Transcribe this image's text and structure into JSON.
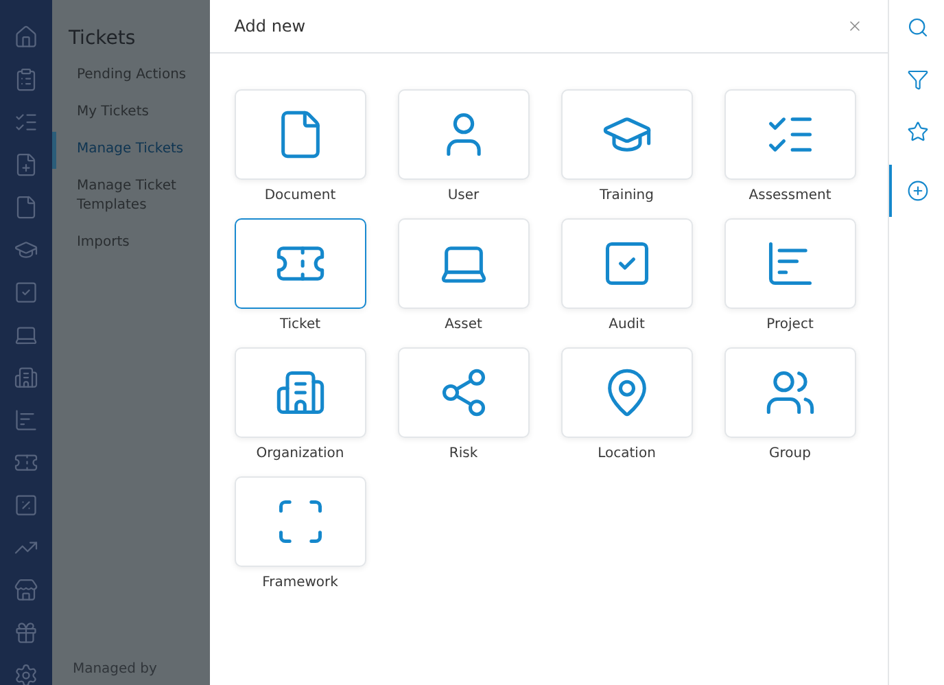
{
  "icon_rail": {
    "items": [
      {
        "kind": "home"
      },
      {
        "kind": "clipboard"
      },
      {
        "kind": "checklist"
      },
      {
        "kind": "file-plus"
      },
      {
        "kind": "file"
      },
      {
        "kind": "cap"
      },
      {
        "kind": "audit"
      },
      {
        "kind": "laptop"
      },
      {
        "kind": "building"
      },
      {
        "kind": "chart"
      },
      {
        "kind": "ticket"
      },
      {
        "kind": "percent"
      },
      {
        "kind": "trend"
      },
      {
        "kind": "store"
      },
      {
        "kind": "gift"
      },
      {
        "kind": "settings"
      }
    ]
  },
  "sidebar": {
    "title": "Tickets",
    "items": [
      {
        "label": "Pending Actions",
        "selected": false
      },
      {
        "label": "My Tickets",
        "selected": false
      },
      {
        "label": "Manage Tickets",
        "selected": true
      },
      {
        "label": "Manage Ticket Templates",
        "selected": false
      },
      {
        "label": "Imports",
        "selected": false
      }
    ],
    "footer": "Managed by"
  },
  "dialog": {
    "title": "Add new",
    "options": [
      {
        "label": "Document",
        "kind": "file",
        "selected": false
      },
      {
        "label": "User",
        "kind": "user",
        "selected": false
      },
      {
        "label": "Training",
        "kind": "cap",
        "selected": false
      },
      {
        "label": "Assessment",
        "kind": "checklist",
        "selected": false
      },
      {
        "label": "Ticket",
        "kind": "ticket",
        "selected": true
      },
      {
        "label": "Asset",
        "kind": "laptop",
        "selected": false
      },
      {
        "label": "Audit",
        "kind": "audit",
        "selected": false
      },
      {
        "label": "Project",
        "kind": "chart",
        "selected": false
      },
      {
        "label": "Organization",
        "kind": "building",
        "selected": false
      },
      {
        "label": "Risk",
        "kind": "network",
        "selected": false
      },
      {
        "label": "Location",
        "kind": "pin",
        "selected": false
      },
      {
        "label": "Group",
        "kind": "users",
        "selected": false
      },
      {
        "label": "Framework",
        "kind": "frame",
        "selected": false
      }
    ]
  },
  "right_rail": {
    "items": [
      {
        "kind": "search",
        "selected": false
      },
      {
        "kind": "filter",
        "selected": false
      },
      {
        "kind": "star",
        "selected": false
      },
      {
        "kind": "add",
        "selected": true
      }
    ]
  }
}
